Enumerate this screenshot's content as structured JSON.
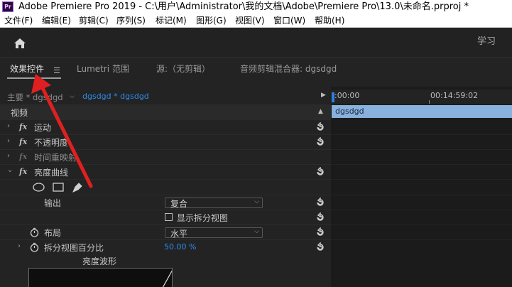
{
  "window": {
    "title": "Adobe Premiere Pro 2019 - C:\\用户\\Administrator\\我的文档\\Adobe\\Premiere Pro\\13.0\\未命名.prproj *",
    "app_icon_text": "Pr"
  },
  "menu": [
    "文件(F)",
    "编辑(E)",
    "剪辑(C)",
    "序列(S)",
    "标记(M)",
    "图形(G)",
    "视图(V)",
    "窗口(W)",
    "帮助(H)"
  ],
  "header": {
    "learn_label": "学习",
    "home_icon": "home-icon"
  },
  "tabs": {
    "effect_controls": "效果控件",
    "lumetri": "Lumetri 范围",
    "source": "源:（无剪辑）",
    "audio_mixer": "音频剪辑混合器: dgsdgd"
  },
  "effect_controls": {
    "clip_label": "主要 * dgsdgd",
    "sequence_clip": "dgsdgd * dgsdgd",
    "video_header": "视频",
    "effects": {
      "motion": "运动",
      "opacity": "不透明度",
      "time_remap": "时间重映射",
      "brightness_curves": "亮度曲线"
    },
    "output_label": "输出",
    "output_value": "复合",
    "split_view_checkbox": "显示拆分视图",
    "layout_label": "布局",
    "layout_value": "水平",
    "split_percent_label": "拆分视图百分比",
    "split_percent_value": "50.00 %",
    "waveform_title": "亮度波形"
  },
  "timeline": {
    "timecode_start": ":00:00",
    "timecode_end": "00:14:59:02",
    "clip_name": "dgsdgd"
  },
  "colors": {
    "accent_blue": "#2d8ceb",
    "clip_blue": "#88b1dd",
    "annotation_red": "#e02020",
    "panel_bg": "#232323"
  }
}
